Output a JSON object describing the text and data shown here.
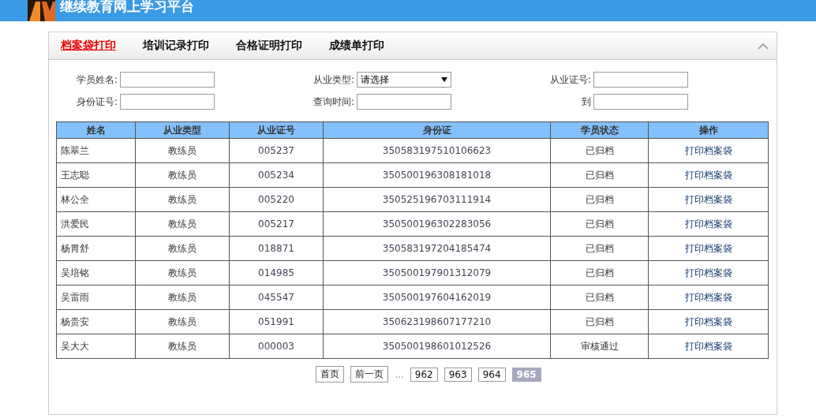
{
  "header": {
    "title": "继续教育网上学习平台"
  },
  "tabs": [
    {
      "label": "档案袋打印",
      "selected": true
    },
    {
      "label": "培训记录打印",
      "selected": false
    },
    {
      "label": "合格证明打印",
      "selected": false
    },
    {
      "label": "成绩单打印",
      "selected": false
    }
  ],
  "form": {
    "rows": [
      [
        {
          "label": "学员姓名:",
          "kind": "input"
        },
        {
          "label": "从业类型:",
          "kind": "select",
          "value": "请选择"
        },
        {
          "label": "从业证号:",
          "kind": "input"
        }
      ],
      [
        {
          "label": "身份证号:",
          "kind": "input"
        },
        {
          "label": "查询时间:",
          "kind": "input"
        },
        {
          "label": "到",
          "kind": "input"
        }
      ]
    ]
  },
  "table": {
    "columns": [
      "姓名",
      "从业类型",
      "从业证号",
      "身份证",
      "学员状态",
      "操作"
    ],
    "rows": [
      [
        "陈翠兰",
        "教练员",
        "005237",
        "350583197510106623",
        "已归档",
        "打印档案袋"
      ],
      [
        "王志聪",
        "教练员",
        "005234",
        "350500196308181018",
        "已归档",
        "打印档案袋"
      ],
      [
        "林公全",
        "教练员",
        "005220",
        "350525196703111914",
        "已归档",
        "打印档案袋"
      ],
      [
        "洪爱民",
        "教练员",
        "005217",
        "350500196302283056",
        "已归档",
        "打印档案袋"
      ],
      [
        "杨胃舒",
        "教练员",
        "018871",
        "350583197204185474",
        "已归档",
        "打印档案袋"
      ],
      [
        "吴培铭",
        "教练员",
        "014985",
        "350500197901312079",
        "已归档",
        "打印档案袋"
      ],
      [
        "吴雷雨",
        "教练员",
        "045547",
        "350500197604162019",
        "已归档",
        "打印档案袋"
      ],
      [
        "杨贵安",
        "教练员",
        "051991",
        "350623198607177210",
        "已归档",
        "打印档案袋"
      ],
      [
        "吴大大",
        "教练员",
        "000003",
        "350500198601012526",
        "审核通过",
        "打印档案袋"
      ]
    ]
  },
  "pager": {
    "nav": [
      "首页",
      "前一页"
    ],
    "ellipsis": "...",
    "pages": [
      {
        "label": "962",
        "selected": false
      },
      {
        "label": "963",
        "selected": false
      },
      {
        "label": "964",
        "selected": false
      },
      {
        "label": "965",
        "selected": true
      }
    ]
  }
}
